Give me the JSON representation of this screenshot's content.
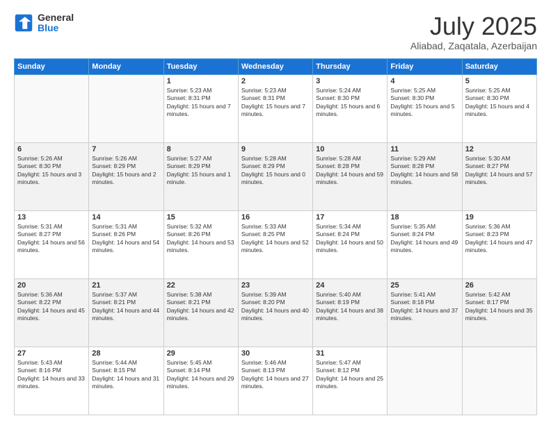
{
  "logo": {
    "general": "General",
    "blue": "Blue"
  },
  "header": {
    "month": "July 2025",
    "location": "Aliabad, Zaqatala, Azerbaijan"
  },
  "weekdays": [
    "Sunday",
    "Monday",
    "Tuesday",
    "Wednesday",
    "Thursday",
    "Friday",
    "Saturday"
  ],
  "weeks": [
    [
      {
        "day": "",
        "empty": true
      },
      {
        "day": "",
        "empty": true
      },
      {
        "day": "1",
        "sunrise": "Sunrise: 5:23 AM",
        "sunset": "Sunset: 8:31 PM",
        "daylight": "Daylight: 15 hours and 7 minutes."
      },
      {
        "day": "2",
        "sunrise": "Sunrise: 5:23 AM",
        "sunset": "Sunset: 8:31 PM",
        "daylight": "Daylight: 15 hours and 7 minutes."
      },
      {
        "day": "3",
        "sunrise": "Sunrise: 5:24 AM",
        "sunset": "Sunset: 8:30 PM",
        "daylight": "Daylight: 15 hours and 6 minutes."
      },
      {
        "day": "4",
        "sunrise": "Sunrise: 5:25 AM",
        "sunset": "Sunset: 8:30 PM",
        "daylight": "Daylight: 15 hours and 5 minutes."
      },
      {
        "day": "5",
        "sunrise": "Sunrise: 5:25 AM",
        "sunset": "Sunset: 8:30 PM",
        "daylight": "Daylight: 15 hours and 4 minutes."
      }
    ],
    [
      {
        "day": "6",
        "sunrise": "Sunrise: 5:26 AM",
        "sunset": "Sunset: 8:30 PM",
        "daylight": "Daylight: 15 hours and 3 minutes."
      },
      {
        "day": "7",
        "sunrise": "Sunrise: 5:26 AM",
        "sunset": "Sunset: 8:29 PM",
        "daylight": "Daylight: 15 hours and 2 minutes."
      },
      {
        "day": "8",
        "sunrise": "Sunrise: 5:27 AM",
        "sunset": "Sunset: 8:29 PM",
        "daylight": "Daylight: 15 hours and 1 minute."
      },
      {
        "day": "9",
        "sunrise": "Sunrise: 5:28 AM",
        "sunset": "Sunset: 8:29 PM",
        "daylight": "Daylight: 15 hours and 0 minutes."
      },
      {
        "day": "10",
        "sunrise": "Sunrise: 5:28 AM",
        "sunset": "Sunset: 8:28 PM",
        "daylight": "Daylight: 14 hours and 59 minutes."
      },
      {
        "day": "11",
        "sunrise": "Sunrise: 5:29 AM",
        "sunset": "Sunset: 8:28 PM",
        "daylight": "Daylight: 14 hours and 58 minutes."
      },
      {
        "day": "12",
        "sunrise": "Sunrise: 5:30 AM",
        "sunset": "Sunset: 8:27 PM",
        "daylight": "Daylight: 14 hours and 57 minutes."
      }
    ],
    [
      {
        "day": "13",
        "sunrise": "Sunrise: 5:31 AM",
        "sunset": "Sunset: 8:27 PM",
        "daylight": "Daylight: 14 hours and 56 minutes."
      },
      {
        "day": "14",
        "sunrise": "Sunrise: 5:31 AM",
        "sunset": "Sunset: 8:26 PM",
        "daylight": "Daylight: 14 hours and 54 minutes."
      },
      {
        "day": "15",
        "sunrise": "Sunrise: 5:32 AM",
        "sunset": "Sunset: 8:26 PM",
        "daylight": "Daylight: 14 hours and 53 minutes."
      },
      {
        "day": "16",
        "sunrise": "Sunrise: 5:33 AM",
        "sunset": "Sunset: 8:25 PM",
        "daylight": "Daylight: 14 hours and 52 minutes."
      },
      {
        "day": "17",
        "sunrise": "Sunrise: 5:34 AM",
        "sunset": "Sunset: 8:24 PM",
        "daylight": "Daylight: 14 hours and 50 minutes."
      },
      {
        "day": "18",
        "sunrise": "Sunrise: 5:35 AM",
        "sunset": "Sunset: 8:24 PM",
        "daylight": "Daylight: 14 hours and 49 minutes."
      },
      {
        "day": "19",
        "sunrise": "Sunrise: 5:36 AM",
        "sunset": "Sunset: 8:23 PM",
        "daylight": "Daylight: 14 hours and 47 minutes."
      }
    ],
    [
      {
        "day": "20",
        "sunrise": "Sunrise: 5:36 AM",
        "sunset": "Sunset: 8:22 PM",
        "daylight": "Daylight: 14 hours and 45 minutes."
      },
      {
        "day": "21",
        "sunrise": "Sunrise: 5:37 AM",
        "sunset": "Sunset: 8:21 PM",
        "daylight": "Daylight: 14 hours and 44 minutes."
      },
      {
        "day": "22",
        "sunrise": "Sunrise: 5:38 AM",
        "sunset": "Sunset: 8:21 PM",
        "daylight": "Daylight: 14 hours and 42 minutes."
      },
      {
        "day": "23",
        "sunrise": "Sunrise: 5:39 AM",
        "sunset": "Sunset: 8:20 PM",
        "daylight": "Daylight: 14 hours and 40 minutes."
      },
      {
        "day": "24",
        "sunrise": "Sunrise: 5:40 AM",
        "sunset": "Sunset: 8:19 PM",
        "daylight": "Daylight: 14 hours and 38 minutes."
      },
      {
        "day": "25",
        "sunrise": "Sunrise: 5:41 AM",
        "sunset": "Sunset: 8:18 PM",
        "daylight": "Daylight: 14 hours and 37 minutes."
      },
      {
        "day": "26",
        "sunrise": "Sunrise: 5:42 AM",
        "sunset": "Sunset: 8:17 PM",
        "daylight": "Daylight: 14 hours and 35 minutes."
      }
    ],
    [
      {
        "day": "27",
        "sunrise": "Sunrise: 5:43 AM",
        "sunset": "Sunset: 8:16 PM",
        "daylight": "Daylight: 14 hours and 33 minutes."
      },
      {
        "day": "28",
        "sunrise": "Sunrise: 5:44 AM",
        "sunset": "Sunset: 8:15 PM",
        "daylight": "Daylight: 14 hours and 31 minutes."
      },
      {
        "day": "29",
        "sunrise": "Sunrise: 5:45 AM",
        "sunset": "Sunset: 8:14 PM",
        "daylight": "Daylight: 14 hours and 29 minutes."
      },
      {
        "day": "30",
        "sunrise": "Sunrise: 5:46 AM",
        "sunset": "Sunset: 8:13 PM",
        "daylight": "Daylight: 14 hours and 27 minutes."
      },
      {
        "day": "31",
        "sunrise": "Sunrise: 5:47 AM",
        "sunset": "Sunset: 8:12 PM",
        "daylight": "Daylight: 14 hours and 25 minutes."
      },
      {
        "day": "",
        "empty": true
      },
      {
        "day": "",
        "empty": true
      }
    ]
  ]
}
